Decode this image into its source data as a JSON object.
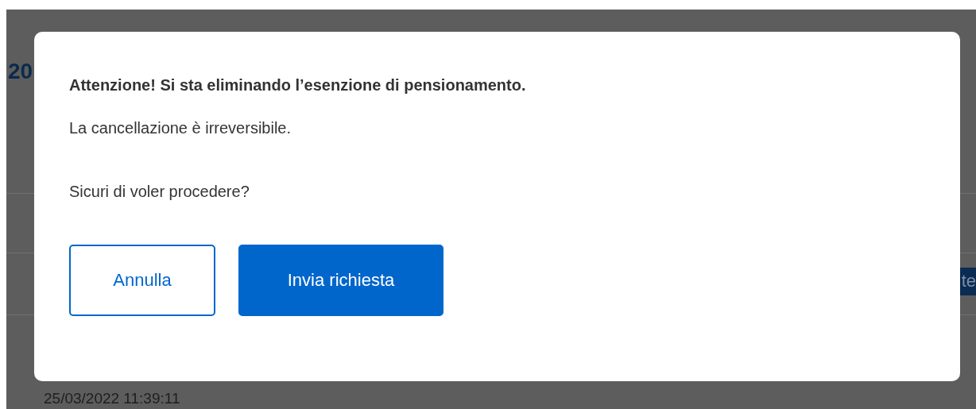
{
  "background_page": {
    "heading_fragment": "20",
    "button_fragment": "te",
    "timestamp": "25/03/2022 11:39:11"
  },
  "dialog": {
    "title": "Attenzione! Si sta eliminando l’esenzione di pensionamento.",
    "message": "La cancellazione è irreversibile.",
    "question": "Sicuri di voler procedere?",
    "buttons": [
      {
        "label": "Annulla",
        "kind": "secondary"
      },
      {
        "label": "Invia richiesta",
        "kind": "primary"
      }
    ]
  }
}
